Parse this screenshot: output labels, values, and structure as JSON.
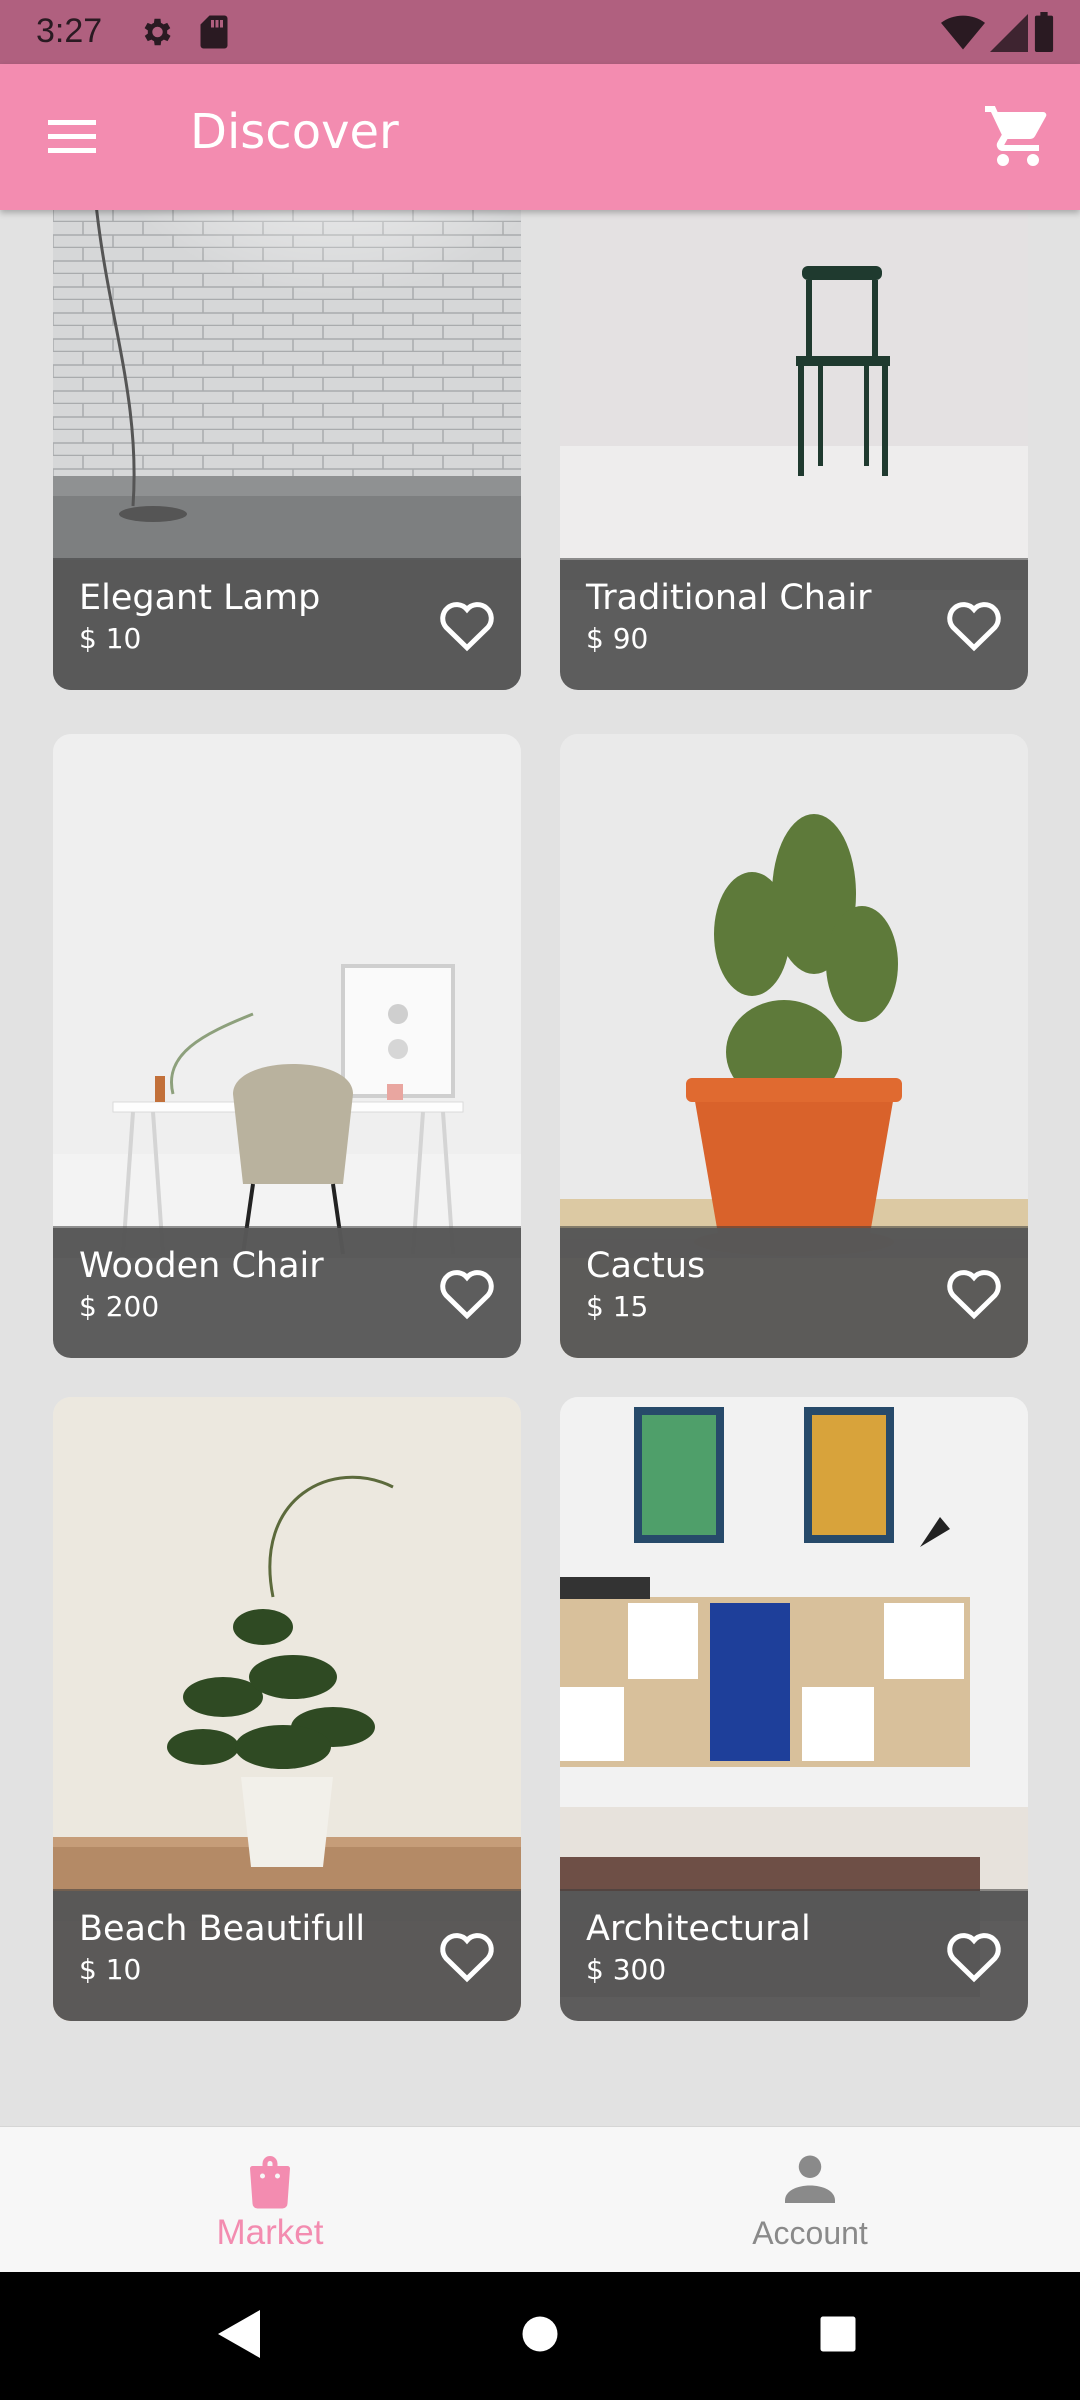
{
  "status_bar": {
    "time": "3:27"
  },
  "app_bar": {
    "title": "Discover"
  },
  "products": [
    {
      "name": "Elegant Lamp",
      "price": "$ 10"
    },
    {
      "name": "Traditional Chair",
      "price": "$ 90"
    },
    {
      "name": "Wooden Chair",
      "price": "$ 200"
    },
    {
      "name": "Cactus",
      "price": "$ 15"
    },
    {
      "name": "Beach Beautifull",
      "price": "$ 10"
    },
    {
      "name": "Architectural",
      "price": "$ 300"
    }
  ],
  "bottom_nav": {
    "items": [
      {
        "label": "Market",
        "icon": "shopping-bag-icon",
        "active": true
      },
      {
        "label": "Account",
        "icon": "person-icon",
        "active": false
      }
    ]
  },
  "colors": {
    "accent": "#f38cb0",
    "status_bar": "#b0607f",
    "caption_bg": "#585858"
  }
}
